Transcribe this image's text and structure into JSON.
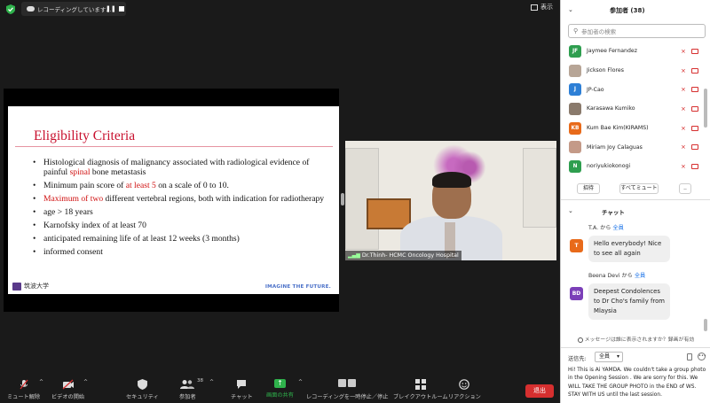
{
  "topbar": {
    "recording_label": "レコーディングしています...",
    "pause_symbol": "❚❚",
    "view_label": "表示"
  },
  "slide": {
    "title": "Eligibility Criteria",
    "bullets": {
      "b1_pre": "Histological diagnosis of malignancy associated with radiological evidence of painful ",
      "b1_red": "spinal",
      "b1_post": " bone metastasis",
      "b2_pre": "Minimum pain score of ",
      "b2_red": "at least 5",
      "b2_post": " on a scale of 0 to 10.",
      "b3_red": "Maximum of two",
      "b3_post": " different vertebral regions, both with indication for radiotherapy",
      "b4": "age > 18 years",
      "b5": "Karnofsky index of at least 70",
      "b6": "anticipated remaining life of at least 12 weeks (3 months)",
      "b7": "informed consent"
    },
    "logo_text": "筑波大学",
    "tagline": "IMAGINE THE FUTURE."
  },
  "video": {
    "name": "Dr.Thinh- HCMC Oncology Hospital"
  },
  "toolbar": {
    "unmute": "ミュート解除",
    "start_video": "ビデオの開始",
    "security": "セキュリティ",
    "participants": "参加者",
    "participants_count": "38",
    "chat": "チャット",
    "share_screen": "画面の共有",
    "pause_recording": "レコーディングを一時停止／停止",
    "breakout": "ブレイクアウトルーム",
    "reactions": "リアクション",
    "end": "退出"
  },
  "participants_panel": {
    "title": "参加者 (38)",
    "search_placeholder": "参加者の検索",
    "participants": [
      {
        "initials": "JF",
        "name": "Jaymee Fernandez",
        "color": "#2e9e4f",
        "photo": false
      },
      {
        "initials": "",
        "name": "Jickson Flores",
        "color": "#b7a596",
        "photo": true
      },
      {
        "initials": "J",
        "name": "JP-Cao",
        "color": "#2d7fd6",
        "photo": false
      },
      {
        "initials": "",
        "name": "Karasawa Kumiko",
        "color": "#8a7a6c",
        "photo": true
      },
      {
        "initials": "KB",
        "name": "Kum Bae Kim(KIRAMS)",
        "color": "#e86a1a",
        "photo": false
      },
      {
        "initials": "",
        "name": "Miriam Joy Calaguas",
        "color": "#c49a88",
        "photo": true
      },
      {
        "initials": "N",
        "name": "noriyukiokonogi",
        "color": "#2e9e4f",
        "photo": false
      }
    ],
    "invite_label": "招待",
    "mute_all_label": "すべてミュート",
    "more_label": ".."
  },
  "chat": {
    "title": "チャット",
    "messages": [
      {
        "initials": "T",
        "color": "#e86a1a",
        "sender": "T.A.",
        "to": "全員",
        "text": "Hello everybody! Nice to see all again"
      },
      {
        "initials": "BD",
        "color": "#7b3fb8",
        "sender": "Beena Devi",
        "to": "全員",
        "text": "Deepest Condolences to Dr Cho's family from Mlaysia"
      }
    ],
    "from_word": "から",
    "notice": "メッセージは誰に表示されますか？録画が有効",
    "to_label": "送信先:",
    "to_value": "全員",
    "draft": "Hi! This is Ai YAMDA. We couldn't take a group photo in the Opening Session . We are sorry for this. We WILL TAKE THE GROUP PHOTO in the END of WS. STAY WITH US until the last session."
  }
}
